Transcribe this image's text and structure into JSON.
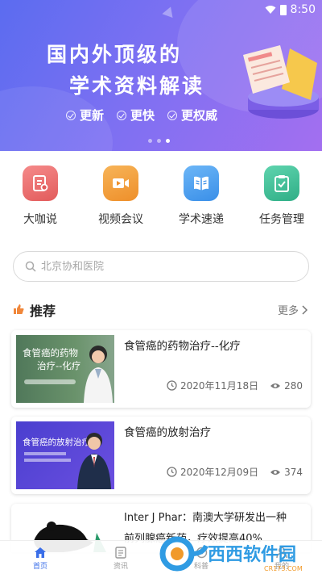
{
  "status": {
    "time": "8:50"
  },
  "banner": {
    "title_line1": "国内外顶级的",
    "title_line2": "学术资料解读",
    "features": [
      "更新",
      "更快",
      "更权威"
    ],
    "slide_count": 3,
    "active_slide": 3
  },
  "quick_menu": [
    {
      "label": "大咖说",
      "icon": "document-icon",
      "color": "#ec6e6e"
    },
    {
      "label": "视频会议",
      "icon": "video-icon",
      "color": "#f2a03c"
    },
    {
      "label": "学术速递",
      "icon": "book-icon",
      "color": "#4a9ff0"
    },
    {
      "label": "任务管理",
      "icon": "clipboard-icon",
      "color": "#3fbf9a"
    }
  ],
  "search": {
    "placeholder": "北京协和医院"
  },
  "section": {
    "title": "推荐",
    "more": "更多"
  },
  "articles": [
    {
      "title": "食管癌的药物治疗--化疗",
      "date": "2020年11月18日",
      "views": "280",
      "thumb_line1": "食管癌的药物",
      "thumb_line2": "治疗--化疗"
    },
    {
      "title": "食管癌的放射治疗",
      "date": "2020年12月09日",
      "views": "374",
      "thumb_line1": "食管癌的放射治疗"
    },
    {
      "title_line1": "Inter J Phar：南澳大学研发出一种",
      "title_line2": "前列腺癌新药，疗效提高40%"
    }
  ],
  "bottom_nav": [
    {
      "label": "首页",
      "active": true
    },
    {
      "label": "资讯",
      "active": false
    },
    {
      "label": "科普",
      "active": false
    },
    {
      "label": "我的",
      "active": false
    }
  ],
  "watermark": {
    "text": "西西软件园",
    "sub": "CR173.COM"
  },
  "colors": {
    "banner_start": "#5b6cf0",
    "banner_end": "#a36ff0",
    "accent": "#3a6ee8"
  }
}
